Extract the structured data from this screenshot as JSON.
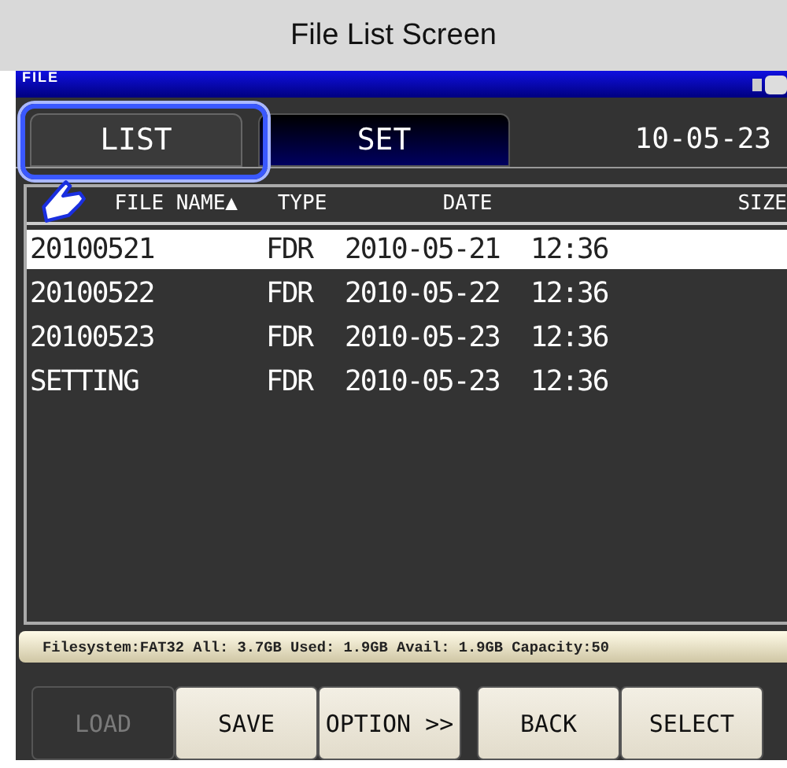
{
  "caption": "File List Screen",
  "screen": {
    "title": "FILE",
    "date": "10-05-23"
  },
  "tabs": [
    {
      "label": "LIST",
      "selected": true
    },
    {
      "label": "SET",
      "selected": false
    }
  ],
  "table": {
    "columns": [
      "FILE NAME▲",
      "TYPE",
      "DATE",
      "SIZE"
    ],
    "rows": [
      {
        "name": "20100521",
        "type": "FDR",
        "date": "2010-05-21  12:36",
        "selected": true
      },
      {
        "name": "20100522",
        "type": "FDR",
        "date": "2010-05-22  12:36",
        "selected": false
      },
      {
        "name": "20100523",
        "type": "FDR",
        "date": "2010-05-23  12:36",
        "selected": false
      },
      {
        "name": "SETTING",
        "type": "FDR",
        "date": "2010-05-23  12:36",
        "selected": false
      }
    ]
  },
  "status_bar": "Filesystem:FAT32 All: 3.7GB Used: 1.9GB Avail: 1.9GB Capacity:50",
  "buttons": [
    {
      "label": "LOAD",
      "disabled": true
    },
    {
      "label": "SAVE",
      "disabled": false
    },
    {
      "label": "OPTION >>",
      "disabled": false
    },
    {
      "label": "BACK",
      "disabled": false
    },
    {
      "label": "SELECT",
      "disabled": false
    }
  ]
}
